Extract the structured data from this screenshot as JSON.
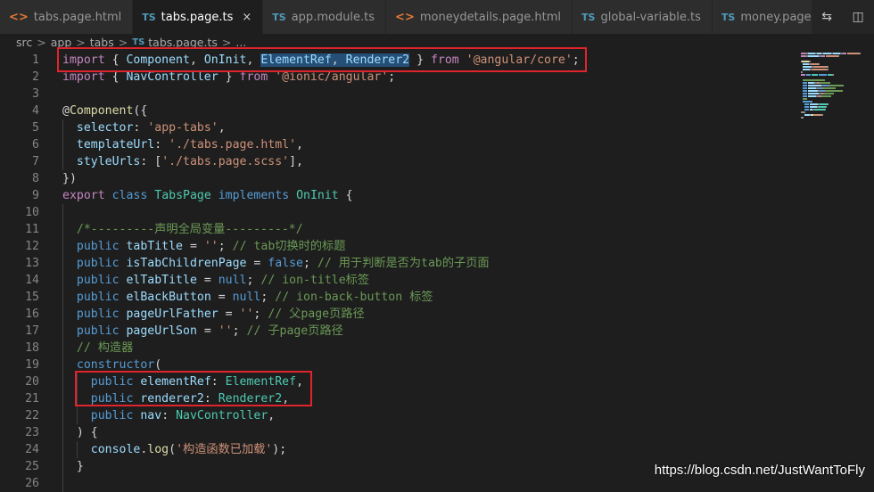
{
  "tabs": [
    {
      "icon": "<>",
      "label": "tabs.page.html",
      "kind": "html"
    },
    {
      "icon": "TS",
      "label": "tabs.page.ts",
      "kind": "ts",
      "active": true,
      "close": "×"
    },
    {
      "icon": "TS",
      "label": "app.module.ts",
      "kind": "ts"
    },
    {
      "icon": "<>",
      "label": "moneydetails.page.html",
      "kind": "html"
    },
    {
      "icon": "TS",
      "label": "global-variable.ts",
      "kind": "ts"
    },
    {
      "icon": "TS",
      "label": "money.page.ts",
      "kind": "ts"
    }
  ],
  "breadcrumb": {
    "items": [
      "src",
      "app",
      "tabs"
    ],
    "file_icon": "TS",
    "file": "tabs.page.ts",
    "sep": ">",
    "tail": "..."
  },
  "code": {
    "lines": [
      {
        "n": "1",
        "tokens": [
          [
            "k",
            "import"
          ],
          [
            "p",
            " { "
          ],
          [
            "id",
            "Component"
          ],
          [
            "p",
            ", "
          ],
          [
            "id",
            "OnInit"
          ],
          [
            "p",
            ", "
          ],
          [
            "idsel",
            "ElementRef"
          ],
          [
            "psel",
            ", "
          ],
          [
            "idsel",
            "Renderer2"
          ],
          [
            "p",
            " } "
          ],
          [
            "k",
            "from"
          ],
          [
            "p",
            " "
          ],
          [
            "s",
            "'@angular/core'"
          ],
          [
            "p",
            ";"
          ]
        ]
      },
      {
        "n": "2",
        "tokens": [
          [
            "k",
            "import"
          ],
          [
            "p",
            " { "
          ],
          [
            "id",
            "NavController"
          ],
          [
            "p",
            " } "
          ],
          [
            "k",
            "from"
          ],
          [
            "p",
            " "
          ],
          [
            "s",
            "'@ionic/angular'"
          ],
          [
            "p",
            ";"
          ]
        ]
      },
      {
        "n": "3",
        "tokens": []
      },
      {
        "n": "4",
        "tokens": [
          [
            "p",
            "@"
          ],
          [
            "f",
            "Component"
          ],
          [
            "p",
            "({"
          ]
        ]
      },
      {
        "n": "5",
        "tokens": [
          [
            "p",
            "  "
          ],
          [
            "id",
            "selector"
          ],
          [
            "p",
            ": "
          ],
          [
            "s",
            "'app-tabs'"
          ],
          [
            "p",
            ","
          ]
        ]
      },
      {
        "n": "6",
        "tokens": [
          [
            "p",
            "  "
          ],
          [
            "id",
            "templateUrl"
          ],
          [
            "p",
            ": "
          ],
          [
            "s",
            "'./tabs.page.html'"
          ],
          [
            "p",
            ","
          ]
        ]
      },
      {
        "n": "7",
        "tokens": [
          [
            "p",
            "  "
          ],
          [
            "id",
            "styleUrls"
          ],
          [
            "p",
            ": ["
          ],
          [
            "s",
            "'./tabs.page.scss'"
          ],
          [
            "p",
            "],"
          ]
        ]
      },
      {
        "n": "8",
        "tokens": [
          [
            "p",
            "})"
          ]
        ]
      },
      {
        "n": "9",
        "tokens": [
          [
            "k",
            "export"
          ],
          [
            "p",
            " "
          ],
          [
            "kb",
            "class"
          ],
          [
            "p",
            " "
          ],
          [
            "t",
            "TabsPage"
          ],
          [
            "p",
            " "
          ],
          [
            "kb",
            "implements"
          ],
          [
            "p",
            " "
          ],
          [
            "t",
            "OnInit"
          ],
          [
            "p",
            " {"
          ]
        ]
      },
      {
        "n": "10",
        "tokens": []
      },
      {
        "n": "11",
        "tokens": [
          [
            "p",
            "  "
          ],
          [
            "c",
            "/*---------声明全局变量---------*/"
          ]
        ]
      },
      {
        "n": "12",
        "tokens": [
          [
            "p",
            "  "
          ],
          [
            "kb",
            "public"
          ],
          [
            "p",
            " "
          ],
          [
            "id",
            "tabTitle"
          ],
          [
            "p",
            " = "
          ],
          [
            "s",
            "''"
          ],
          [
            "p",
            "; "
          ],
          [
            "c",
            "// tab切换时的标题"
          ]
        ]
      },
      {
        "n": "13",
        "tokens": [
          [
            "p",
            "  "
          ],
          [
            "kb",
            "public"
          ],
          [
            "p",
            " "
          ],
          [
            "id",
            "isTabChildrenPage"
          ],
          [
            "p",
            " = "
          ],
          [
            "kb",
            "false"
          ],
          [
            "p",
            "; "
          ],
          [
            "c",
            "// 用于判断是否为tab的子页面"
          ]
        ]
      },
      {
        "n": "14",
        "tokens": [
          [
            "p",
            "  "
          ],
          [
            "kb",
            "public"
          ],
          [
            "p",
            " "
          ],
          [
            "id",
            "elTabTitle"
          ],
          [
            "p",
            " = "
          ],
          [
            "kb",
            "null"
          ],
          [
            "p",
            "; "
          ],
          [
            "c",
            "// ion-title标签"
          ]
        ]
      },
      {
        "n": "15",
        "tokens": [
          [
            "p",
            "  "
          ],
          [
            "kb",
            "public"
          ],
          [
            "p",
            " "
          ],
          [
            "id",
            "elBackButton"
          ],
          [
            "p",
            " = "
          ],
          [
            "kb",
            "null"
          ],
          [
            "p",
            "; "
          ],
          [
            "c",
            "// ion-back-button 标签"
          ]
        ]
      },
      {
        "n": "16",
        "tokens": [
          [
            "p",
            "  "
          ],
          [
            "kb",
            "public"
          ],
          [
            "p",
            " "
          ],
          [
            "id",
            "pageUrlFather"
          ],
          [
            "p",
            " = "
          ],
          [
            "s",
            "''"
          ],
          [
            "p",
            "; "
          ],
          [
            "c",
            "// 父page页路径"
          ]
        ]
      },
      {
        "n": "17",
        "tokens": [
          [
            "p",
            "  "
          ],
          [
            "kb",
            "public"
          ],
          [
            "p",
            " "
          ],
          [
            "id",
            "pageUrlSon"
          ],
          [
            "p",
            " = "
          ],
          [
            "s",
            "''"
          ],
          [
            "p",
            "; "
          ],
          [
            "c",
            "// 子page页路径"
          ]
        ]
      },
      {
        "n": "18",
        "tokens": [
          [
            "p",
            "  "
          ],
          [
            "c",
            "// 构造器"
          ]
        ]
      },
      {
        "n": "19",
        "tokens": [
          [
            "p",
            "  "
          ],
          [
            "kb",
            "constructor"
          ],
          [
            "p",
            "("
          ]
        ]
      },
      {
        "n": "20",
        "tokens": [
          [
            "p",
            "    "
          ],
          [
            "kb",
            "public"
          ],
          [
            "p",
            " "
          ],
          [
            "id",
            "elementRef"
          ],
          [
            "p",
            ": "
          ],
          [
            "t",
            "ElementRef"
          ],
          [
            "p",
            ","
          ]
        ]
      },
      {
        "n": "21",
        "tokens": [
          [
            "p",
            "    "
          ],
          [
            "kb",
            "public"
          ],
          [
            "p",
            " "
          ],
          [
            "id",
            "renderer2"
          ],
          [
            "p",
            ": "
          ],
          [
            "t",
            "Renderer2"
          ],
          [
            "p",
            ","
          ]
        ]
      },
      {
        "n": "22",
        "tokens": [
          [
            "p",
            "    "
          ],
          [
            "kb",
            "public"
          ],
          [
            "p",
            " "
          ],
          [
            "id",
            "nav"
          ],
          [
            "p",
            ": "
          ],
          [
            "t",
            "NavController"
          ],
          [
            "p",
            ","
          ]
        ]
      },
      {
        "n": "23",
        "tokens": [
          [
            "p",
            "  ) {"
          ]
        ]
      },
      {
        "n": "24",
        "tokens": [
          [
            "p",
            "    "
          ],
          [
            "id",
            "console"
          ],
          [
            "p",
            "."
          ],
          [
            "f",
            "log"
          ],
          [
            "p",
            "("
          ],
          [
            "s",
            "'构造函数已加载'"
          ],
          [
            "p",
            ");"
          ]
        ]
      },
      {
        "n": "25",
        "tokens": [
          [
            "p",
            "  }"
          ]
        ]
      },
      {
        "n": "26",
        "tokens": []
      }
    ]
  },
  "watermark": "https://blog.csdn.net/JustWantToFly",
  "colors": {
    "editor_bg": "#1e1e1e",
    "tabbar_bg": "#252526",
    "highlight_box": "#e0242c",
    "selection": "#264f78"
  }
}
